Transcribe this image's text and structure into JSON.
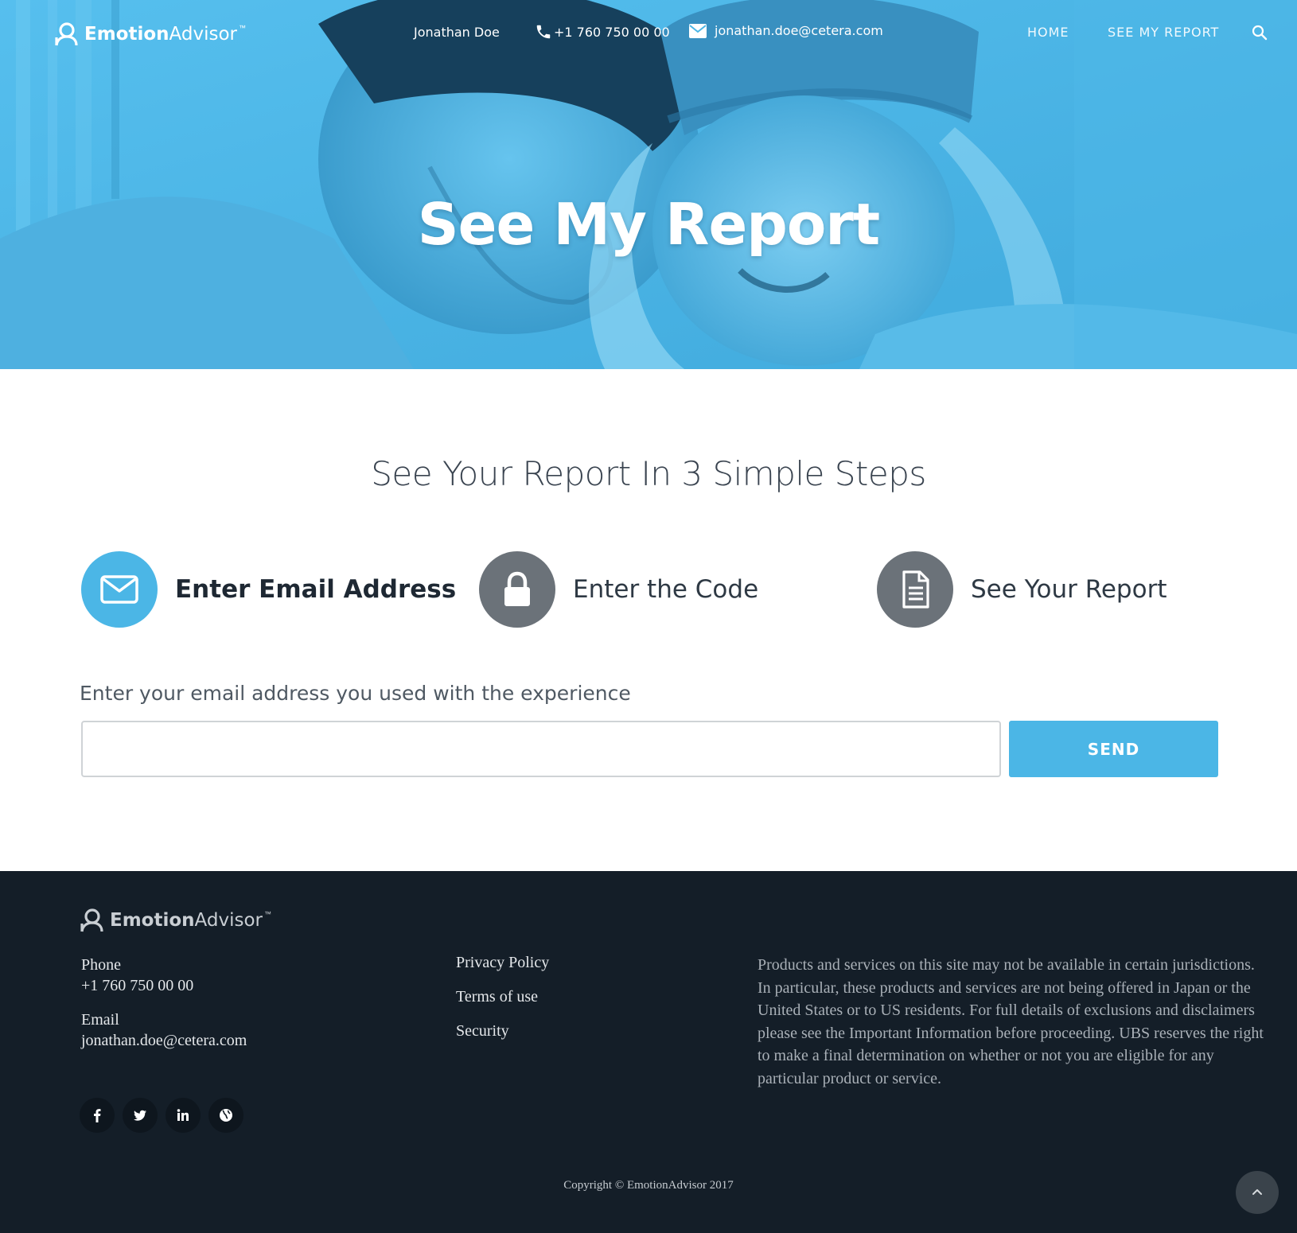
{
  "header": {
    "brand_bold": "Emotion",
    "brand_light": "Advisor",
    "brand_tm": "™",
    "contact_name": "Jonathan Doe",
    "contact_phone": "+1 760 750 00 00",
    "contact_email": "jonathan.doe@cetera.com",
    "nav": {
      "home": "HOME",
      "see_my_report": "SEE MY REPORT"
    },
    "icons": {
      "logo": "user-outline-icon",
      "phone": "phone-icon",
      "email": "envelope-icon",
      "search": "search-icon"
    }
  },
  "hero": {
    "title": "See My Report",
    "overlay_color": "#4bb6e6"
  },
  "steps": {
    "heading": "See Your Report In 3 Simple Steps",
    "items": [
      {
        "label": "Enter Email Address",
        "icon": "envelope-icon",
        "active": true
      },
      {
        "label": "Enter the Code",
        "icon": "lock-icon",
        "active": false
      },
      {
        "label": "See Your Report",
        "icon": "document-icon",
        "active": false
      }
    ],
    "active_color": "#4bb6e6",
    "inactive_color": "#6b7279"
  },
  "form": {
    "prompt": "Enter your email address you used with the experience",
    "email_value": "",
    "email_placeholder": "",
    "send_label": "SEND"
  },
  "footer": {
    "brand_bold": "Emotion",
    "brand_light": "Advisor",
    "brand_tm": "™",
    "phone_label": "Phone",
    "phone_value": "+1 760 750 00 00",
    "email_label": "Email",
    "email_value": "jonathan.doe@cetera.com",
    "links": [
      "Privacy Policy",
      "Terms of use",
      "Security"
    ],
    "disclaimer": "Products and services on this site may not be available in certain jurisdictions. In particular, these products and services are not being offered in Japan or the United States or to US residents. For full details of exclusions and disclaimers please see the Important Information before proceeding. UBS reserves the right to make a final determination on whether or not you are eligible for any particular product or service.",
    "socials": [
      "facebook-icon",
      "twitter-icon",
      "linkedin-icon",
      "globe-icon"
    ],
    "copyright": "Copyright © EmotionAdvisor 2017",
    "background": "#141e28"
  }
}
